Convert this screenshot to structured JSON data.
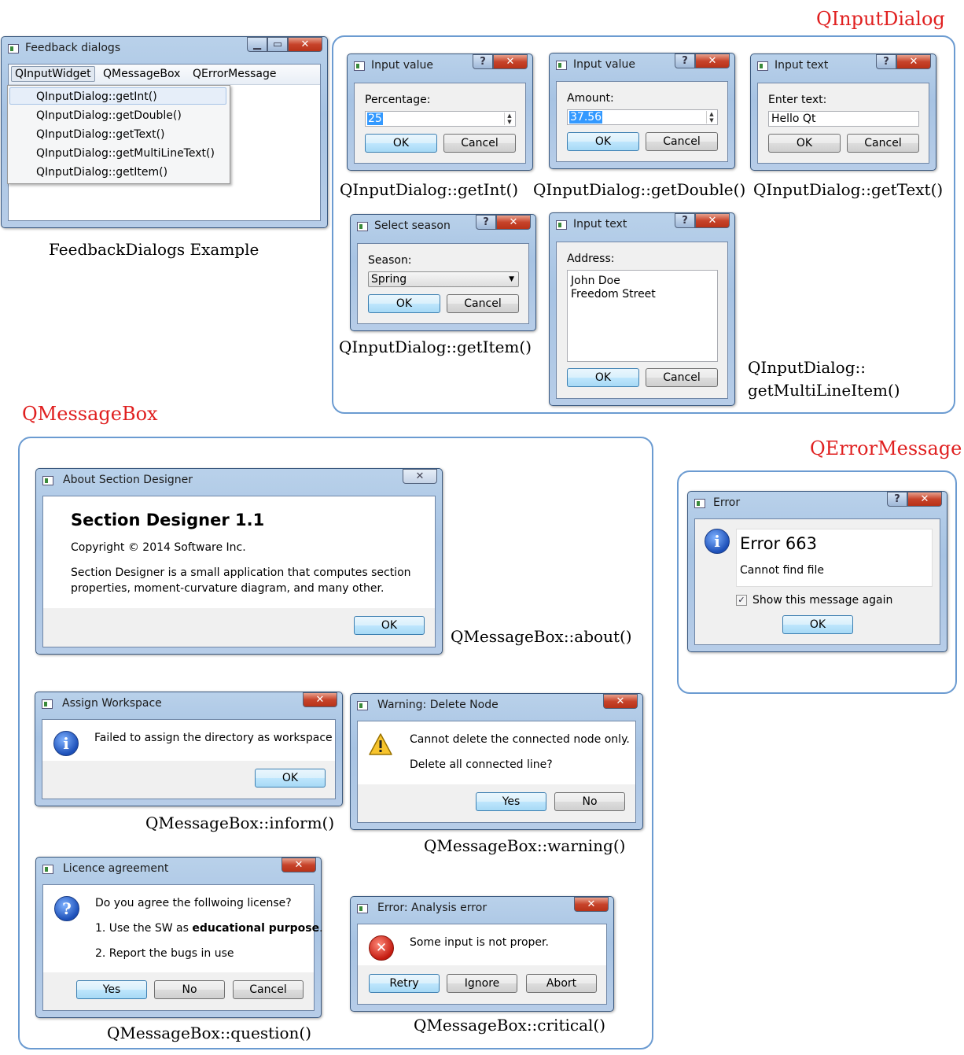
{
  "sections": {
    "input_dialog": "QInputDialog",
    "message_box": "QMessageBox",
    "error_message": "QErrorMessage"
  },
  "colors": {
    "section_title": "#e02020",
    "group_border": "#6b9bd1",
    "title_bar": "#b9d1ea",
    "close_button": "#c7432a",
    "selection": "#3399ff"
  },
  "feedback_window": {
    "title": "Feedback dialogs",
    "menu": [
      "QInputWidget",
      "QMessageBox",
      "QErrorMessage"
    ],
    "items": [
      "QInputDialog::getInt()",
      "QInputDialog::getDouble()",
      "QInputDialog::getText()",
      "QInputDialog::getMultiLineText()",
      "QInputDialog::getItem()"
    ],
    "caption": "FeedbackDialogs Example"
  },
  "get_int": {
    "title": "Input value",
    "label": "Percentage:",
    "value": "25",
    "ok": "OK",
    "cancel": "Cancel",
    "caption": "QInputDialog::getInt()"
  },
  "get_double": {
    "title": "Input value",
    "label": "Amount:",
    "value": "37.56",
    "ok": "OK",
    "cancel": "Cancel",
    "caption": "QInputDialog::getDouble()"
  },
  "get_text": {
    "title": "Input text",
    "label": "Enter text:",
    "value": "Hello Qt",
    "ok": "OK",
    "cancel": "Cancel",
    "caption": "QInputDialog::getText()"
  },
  "get_item": {
    "title": "Select season",
    "label": "Season:",
    "value": "Spring",
    "ok": "OK",
    "cancel": "Cancel",
    "caption": "QInputDialog::getItem()"
  },
  "get_multiline": {
    "title": "Input text",
    "label": "Address:",
    "line1": "John Doe",
    "line2": "Freedom Street",
    "ok": "OK",
    "cancel": "Cancel",
    "caption1": "QInputDialog::",
    "caption2": "getMultiLineItem()"
  },
  "about": {
    "title": "About Section Designer",
    "heading": "Section Designer 1.1",
    "copyright": "Copyright © 2014 Software Inc.",
    "desc1": "Section Designer is a small application that computes section",
    "desc2": "properties, moment-curvature diagram, and many other.",
    "ok": "OK",
    "caption": "QMessageBox::about()"
  },
  "inform": {
    "title": "Assign Workspace",
    "text": "Failed to assign the directory as workspace",
    "ok": "OK",
    "caption": "QMessageBox::inform()"
  },
  "warning": {
    "title": "Warning: Delete Node",
    "text1": "Cannot delete the connected node only.",
    "text2": "Delete all connected line?",
    "yes": "Yes",
    "no": "No",
    "caption": "QMessageBox::warning()"
  },
  "question": {
    "title": "Licence agreement",
    "text1": "Do you agree the follwoing license?",
    "text2a": "1. Use the SW as ",
    "text2b": "educational purpose",
    "text2c": ".",
    "text3": "2. Report the bugs in use",
    "yes": "Yes",
    "no": "No",
    "cancel": "Cancel",
    "caption": "QMessageBox::question()"
  },
  "critical": {
    "title": "Error: Analysis error",
    "text": "Some input is not proper.",
    "retry": "Retry",
    "ignore": "Ignore",
    "abort": "Abort",
    "caption": "QMessageBox::critical()"
  },
  "error_dialog": {
    "title": "Error",
    "heading": "Error 663",
    "text": "Cannot find file",
    "checkbox": "Show this message again",
    "ok": "OK"
  }
}
